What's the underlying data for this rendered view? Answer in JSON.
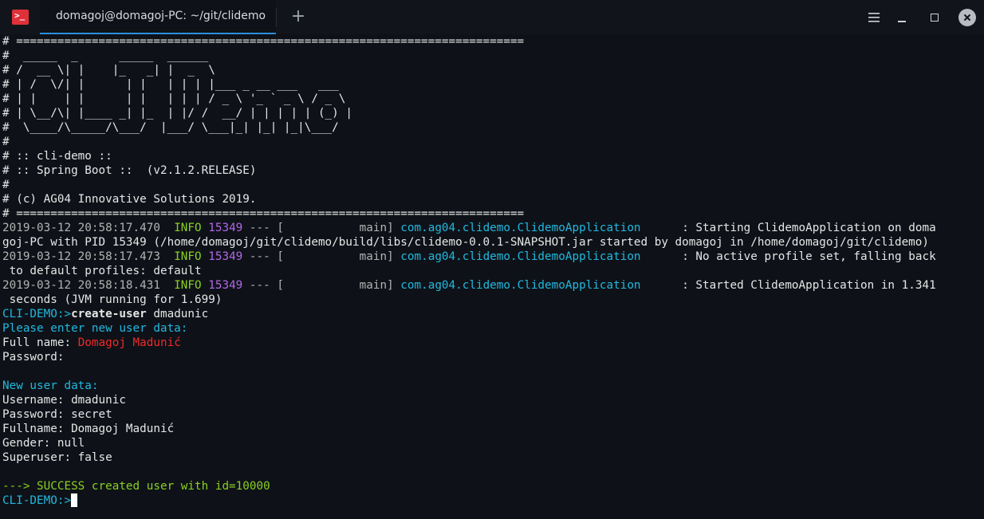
{
  "window": {
    "tab_title": "domagoj@domagoj-PC: ~/git/clidemo",
    "app_icon_glyph": ">_",
    "new_tab_glyph": "+",
    "icons": [
      "terminal-app-icon",
      "plus-icon",
      "hamburger-menu-icon",
      "minimize-icon",
      "maximize-icon",
      "close-icon"
    ]
  },
  "banner": [
    "# ==========================================================================",
    "#  _____  _      _____  ______",
    "# /  __ \\| |    |_   _| |  _  \\",
    "# | /  \\/| |      | |   | | | |___ _ __ ___   ___",
    "# | |    | |      | |   | | | / _ \\ '_ ` _ \\ / _ \\",
    "# | \\__/\\| |____ _| |_  | |/ /  __/ | | | | | (_) |",
    "#  \\____/\\_____/\\___/  |___/ \\___|_| |_| |_|\\___/",
    "#",
    "# :: cli-demo ::",
    "# :: Spring Boot ::  (v2.1.2.RELEASE)",
    "#",
    "# (c) AG04 Innovative Solutions 2019.",
    "# =========================================================================="
  ],
  "logs": [
    {
      "timestamp": "2019-03-12 20:58:17.470",
      "level": "INFO",
      "pid": "15349",
      "sep": "---",
      "thread": "[           main]",
      "logger": "com.ag04.clidemo.ClidemoApplication",
      "message": "Starting ClidemoApplication on doma",
      "continuation": "goj-PC with PID 15349 (/home/domagoj/git/clidemo/build/libs/clidemo-0.0.1-SNAPSHOT.jar started by domagoj in /home/domagoj/git/clidemo)"
    },
    {
      "timestamp": "2019-03-12 20:58:17.473",
      "level": "INFO",
      "pid": "15349",
      "sep": "---",
      "thread": "[           main]",
      "logger": "com.ag04.clidemo.ClidemoApplication",
      "message": "No active profile set, falling back",
      "continuation": " to default profiles: default"
    },
    {
      "timestamp": "2019-03-12 20:58:18.431",
      "level": "INFO",
      "pid": "15349",
      "sep": "---",
      "thread": "[           main]",
      "logger": "com.ag04.clidemo.ClidemoApplication",
      "message": "Started ClidemoApplication in 1.341",
      "continuation": " seconds (JVM running for 1.699)"
    }
  ],
  "session": {
    "prompt": "CLI-DEMO:>",
    "command": "create-user",
    "command_arg": " dmadunic",
    "please_enter": "Please enter new user data:",
    "fullname_label": "Full name: ",
    "fullname_value": "Domagoj Madunić",
    "password_label": "Password:",
    "new_user_data": "New user data:",
    "username_line": "Username: dmadunic",
    "password_line": "Password: secret",
    "fullname_line": "Fullname: Domagoj Madunić",
    "gender_line": "Gender: null",
    "superuser_line": "Superuser: false",
    "success_line": "---> SUCCESS created user with id=10000",
    "final_prompt": "CLI-DEMO:>"
  },
  "colors": {
    "background": "#0e1218",
    "accent_tab_underline": "#2d8fde",
    "info_level": "#8ad022",
    "pid": "#b267e6",
    "logger_and_prompt": "#22b8de",
    "fullname_input": "#ef2a2a",
    "success": "#8ad022"
  }
}
